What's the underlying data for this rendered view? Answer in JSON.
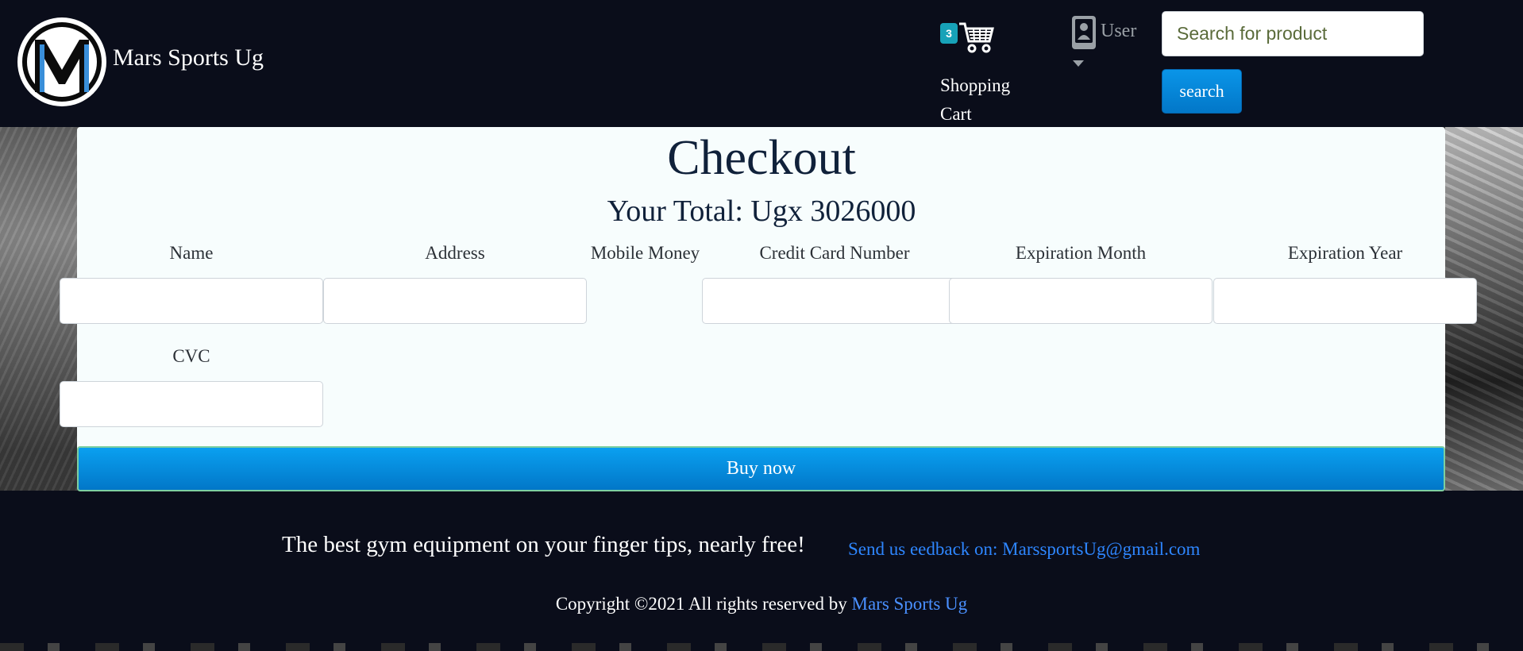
{
  "header": {
    "brand": "Mars Sports Ug",
    "logo_letter": "M",
    "cart": {
      "count": "3",
      "label": "Shopping Cart"
    },
    "user": {
      "label": "User"
    },
    "search": {
      "placeholder": "Search for product",
      "value": "",
      "button_label": "search"
    }
  },
  "checkout": {
    "title": "Checkout",
    "total": "Your Total: Ugx 3026000",
    "fields": {
      "name": "Name",
      "address": "Address",
      "mobile_money": "Mobile Money",
      "card_number": "Credit Card Number",
      "exp_month": "Expiration Month",
      "exp_year": "Expiration Year",
      "cvc": "CVC"
    },
    "buy_label": "Buy now"
  },
  "footer": {
    "tagline": "The best gym equipment on your finger tips, nearly free!",
    "feedback": "Send us eedback on: MarssportsUg@gmail.com",
    "copyright_prefix": "Copyright ©2021 All rights reserved by",
    "copyright_link": "Mars Sports Ug"
  },
  "colors": {
    "background": "#0a0d1a",
    "primary_button": "#0288d1",
    "link": "#2e86ff",
    "badge": "#17a2b8"
  }
}
